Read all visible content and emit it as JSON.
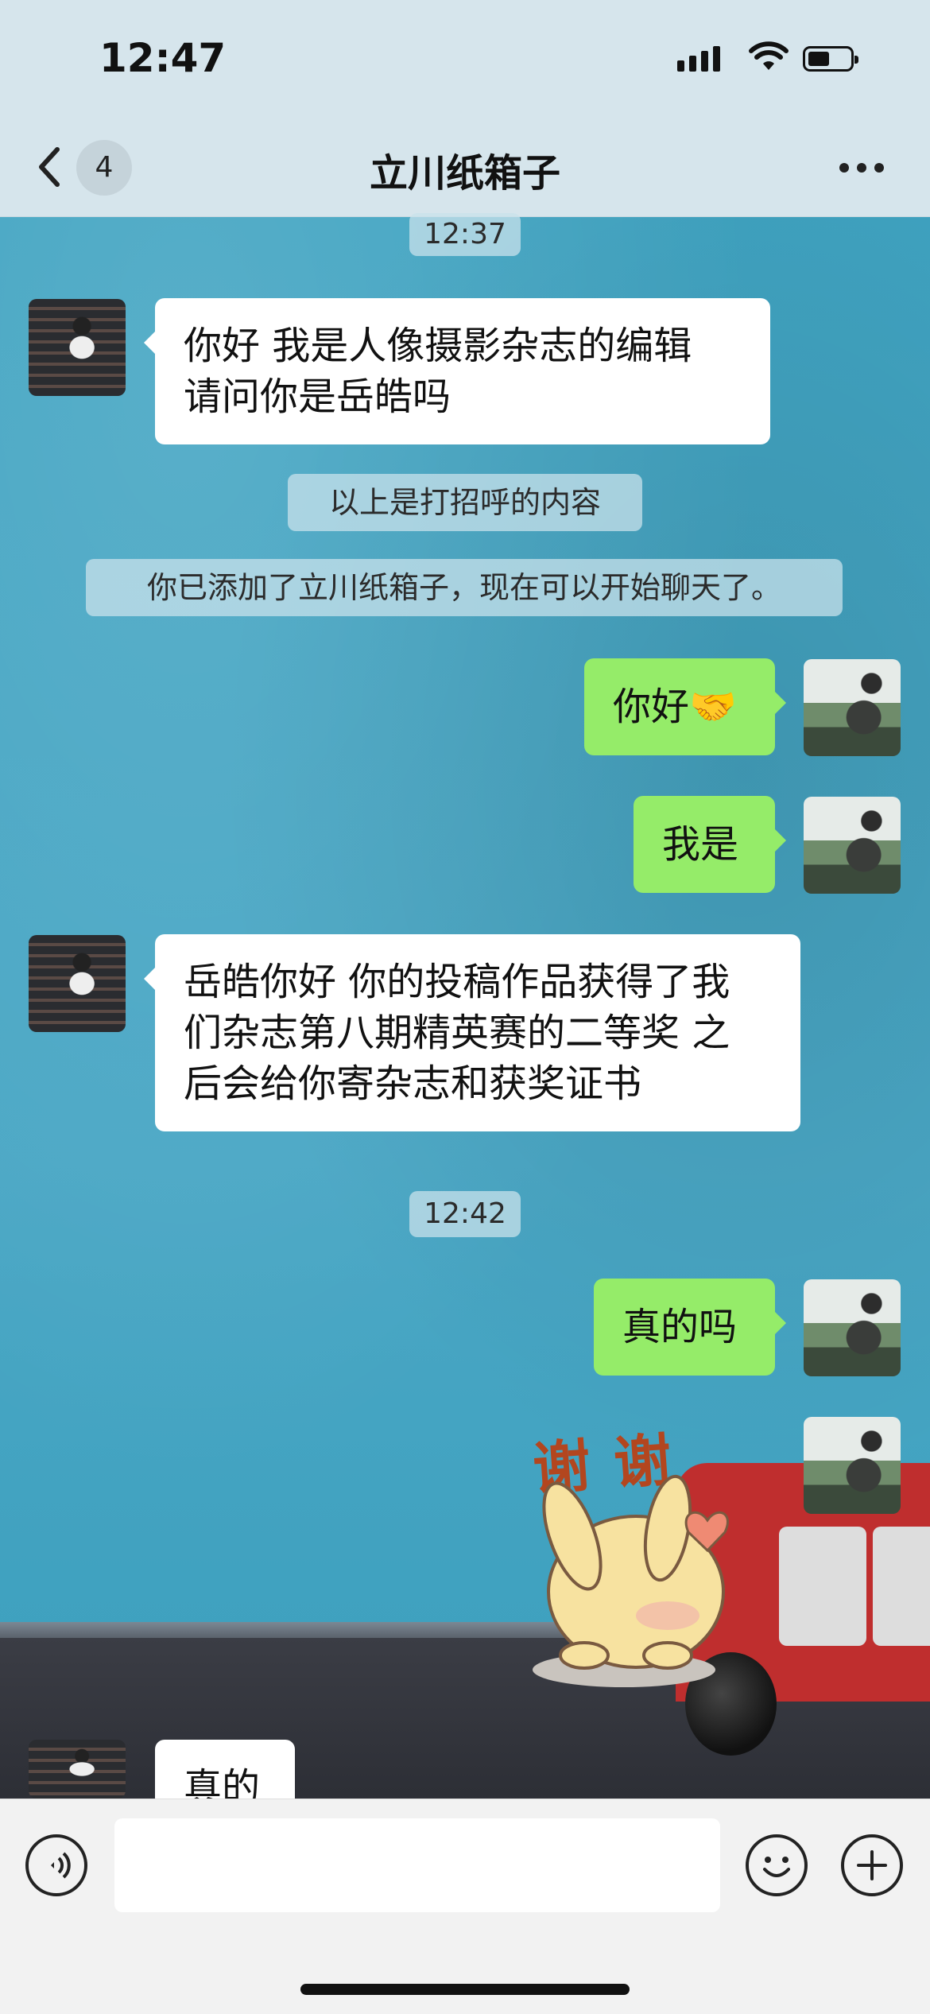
{
  "status_bar": {
    "time": "12:47"
  },
  "nav": {
    "back_badge": "4",
    "title": "立川纸箱子"
  },
  "chat": {
    "timestamps": [
      "12:37",
      "12:42"
    ],
    "system": [
      "以上是打招呼的内容",
      "你已添加了立川纸箱子，现在可以开始聊天了。"
    ],
    "messages": [
      {
        "from": "them",
        "lines": [
          "你好 我是人像摄影杂志的编辑",
          "请问你是岳皓吗"
        ]
      },
      {
        "from": "me",
        "text": "你好🤝"
      },
      {
        "from": "me",
        "text": "我是"
      },
      {
        "from": "them",
        "lines": [
          "岳皓你好 你的投稿作品获得了我",
          "们杂志第八期精英赛的二等奖 之",
          "后会给你寄杂志和获奖证书"
        ]
      },
      {
        "from": "me",
        "text": "真的吗"
      },
      {
        "from": "me",
        "sticker": "谢谢"
      },
      {
        "from": "them",
        "text": "真的"
      }
    ]
  },
  "composer": {
    "voice_icon": "voice-icon",
    "emoji_icon": "emoji-icon",
    "plus_icon": "plus-icon",
    "input_value": ""
  },
  "colors": {
    "me_bubble": "#95ec69",
    "them_bubble": "#ffffff",
    "chat_bg": "#4aa3bf"
  }
}
